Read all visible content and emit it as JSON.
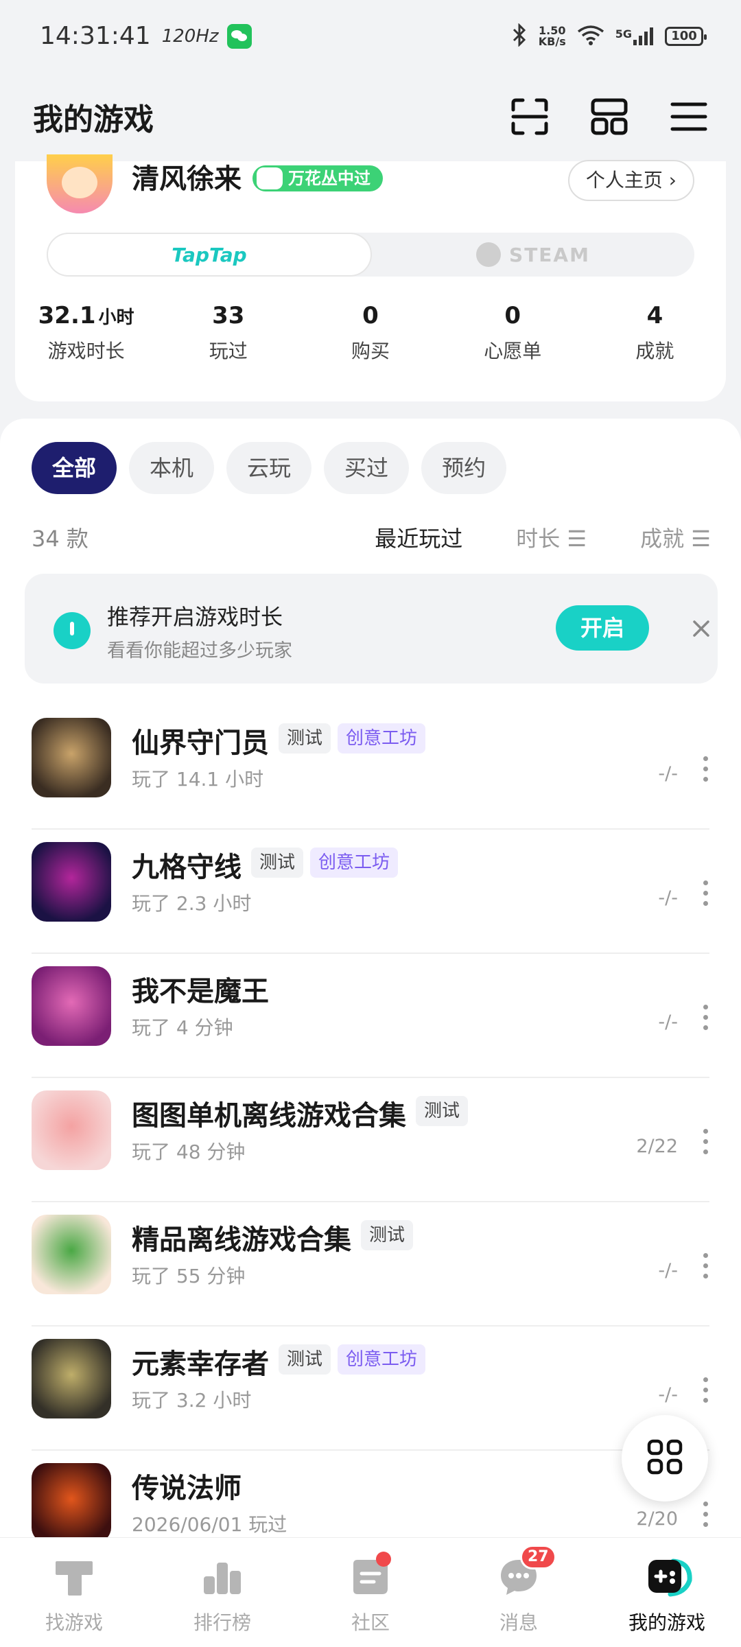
{
  "status": {
    "time": "14:31:41",
    "refresh": "120Hz",
    "speed_value": "1.50",
    "speed_unit": "KB/s",
    "network": "5G",
    "battery": "100"
  },
  "header": {
    "title": "我的游戏"
  },
  "profile": {
    "username": "清风徐来",
    "badge": "万花丛中过",
    "homepage_button": "个人主页 ›",
    "platforms": {
      "taptap": "TapTap",
      "steam": "STEAM"
    },
    "stats": [
      {
        "value": "32.1",
        "unit": "小时",
        "label": "游戏时长"
      },
      {
        "value": "33",
        "unit": "",
        "label": "玩过"
      },
      {
        "value": "0",
        "unit": "",
        "label": "购买"
      },
      {
        "value": "0",
        "unit": "",
        "label": "心愿单"
      },
      {
        "value": "4",
        "unit": "",
        "label": "成就"
      }
    ]
  },
  "filters": [
    "全部",
    "本机",
    "云玩",
    "买过",
    "预约"
  ],
  "list": {
    "count": "34 款",
    "sort": {
      "recent": "最近玩过",
      "duration": "时长 ☰",
      "achievement": "成就 ☰"
    }
  },
  "tip": {
    "title": "推荐开启游戏时长",
    "subtitle": "看看你能超过多少玩家",
    "button": "开启"
  },
  "games": [
    {
      "name": "仙界守门员",
      "tags": [
        "测试",
        "创意工坊"
      ],
      "played": "玩了 14.1 小时",
      "achievement": "-/-",
      "colors": [
        "#3a2d22",
        "#c9a36a"
      ]
    },
    {
      "name": "九格守线",
      "tags": [
        "测试",
        "创意工坊"
      ],
      "played": "玩了 2.3 小时",
      "achievement": "-/-",
      "colors": [
        "#1b1244",
        "#b3269b"
      ]
    },
    {
      "name": "我不是魔王",
      "tags": [],
      "played": "玩了 4 分钟",
      "achievement": "-/-",
      "colors": [
        "#7b1f74",
        "#e36ab6"
      ]
    },
    {
      "name": "图图单机离线游戏合集",
      "tags": [
        "测试"
      ],
      "played": "玩了 48 分钟",
      "achievement": "2/22",
      "colors": [
        "#f6d6d6",
        "#f4a2a2"
      ]
    },
    {
      "name": "精品离线游戏合集",
      "tags": [
        "测试"
      ],
      "played": "玩了 55 分钟",
      "achievement": "-/-",
      "colors": [
        "#f8e7d9",
        "#4aa845"
      ]
    },
    {
      "name": "元素幸存者",
      "tags": [
        "测试",
        "创意工坊"
      ],
      "played": "玩了 3.2 小时",
      "achievement": "-/-",
      "colors": [
        "#333028",
        "#bfae6a"
      ]
    },
    {
      "name": "传说法师",
      "tags": [],
      "played": "2026/06/01 玩过",
      "achievement": "2/20",
      "colors": [
        "#3d0f0f",
        "#e2561c"
      ]
    }
  ],
  "tabbar": [
    {
      "label": "找游戏",
      "icon": "taptap-t-icon"
    },
    {
      "label": "排行榜",
      "icon": "ranking-icon"
    },
    {
      "label": "社区",
      "icon": "community-icon"
    },
    {
      "label": "消息",
      "icon": "message-icon",
      "badge": "27"
    },
    {
      "label": "我的游戏",
      "icon": "gamepad-icon"
    }
  ],
  "accent": "#19d1c6",
  "filter_active_color": "#1e1e6e"
}
